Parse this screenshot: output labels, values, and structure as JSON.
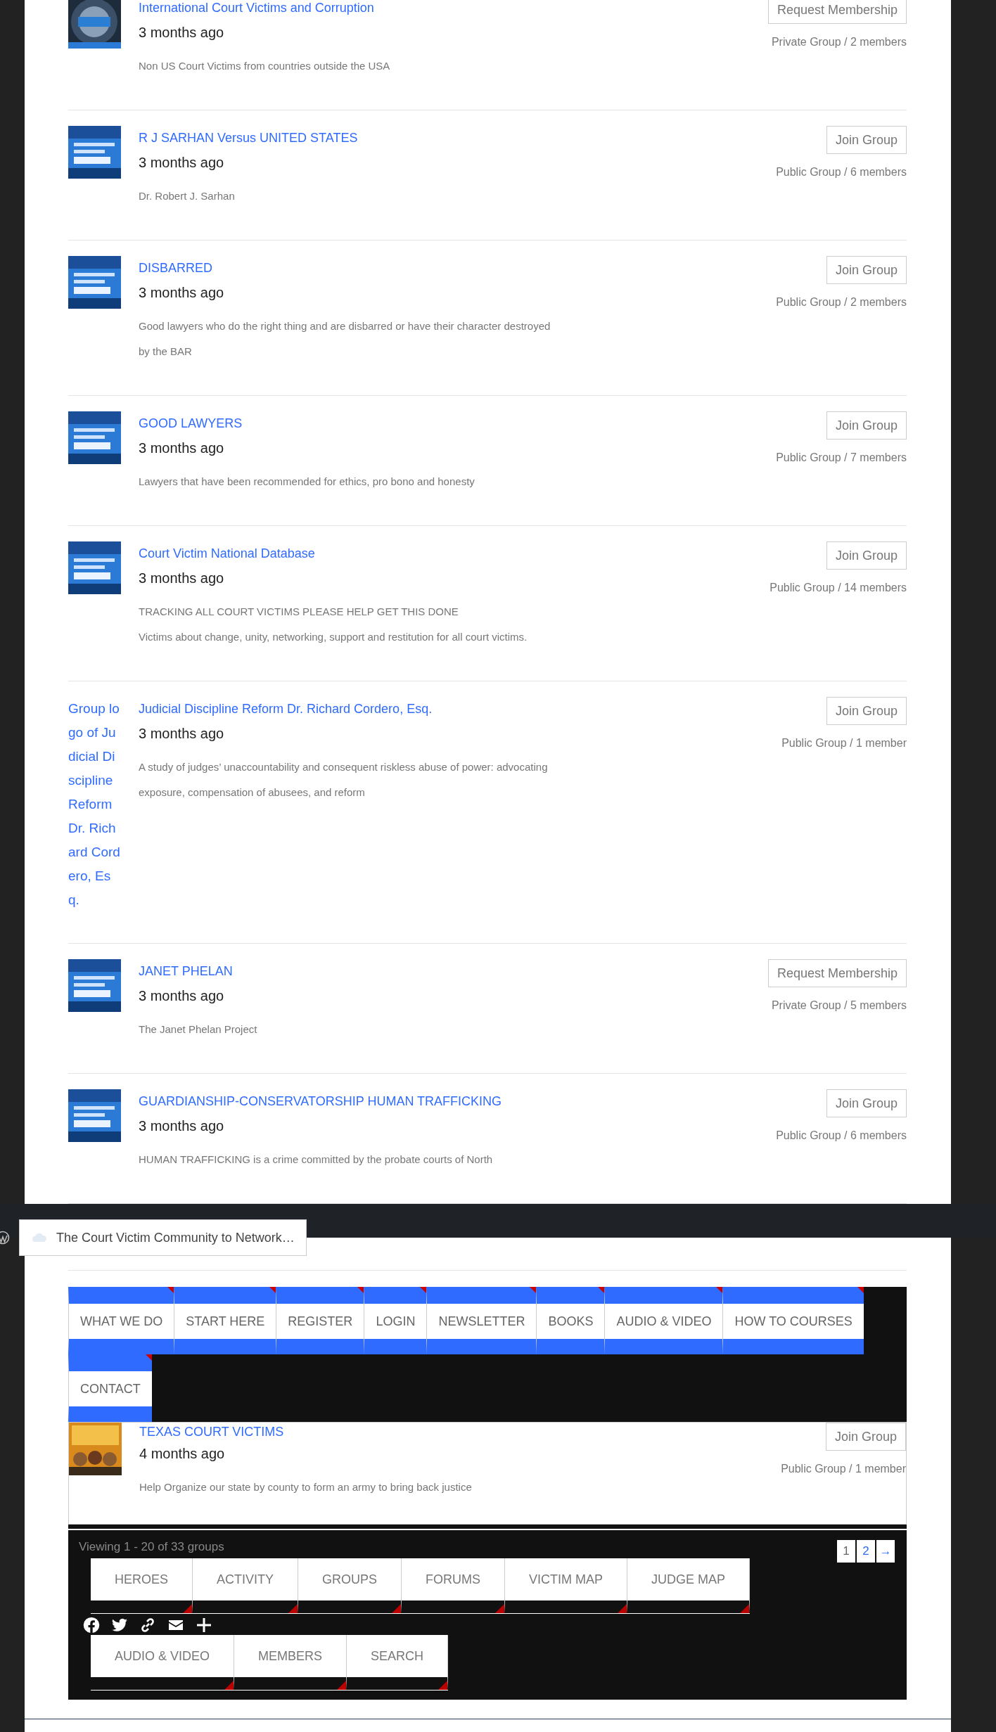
{
  "groups": [
    {
      "avatar": {
        "kind": "picture"
      },
      "title": "International Court Victims and Corruption",
      "time": "3 months ago",
      "description": [
        "Non US Court Victims from countries outside the USA"
      ],
      "action": "Request Membership",
      "meta": "Private Group / 2 members"
    },
    {
      "avatar": {
        "kind": "picture"
      },
      "title": "R J SARHAN Versus UNITED STATES",
      "time": "3 months ago",
      "description": [
        "Dr. Robert J. Sarhan"
      ],
      "action": "Join Group",
      "meta": "Public Group / 6 members"
    },
    {
      "avatar": {
        "kind": "picture"
      },
      "title": "DISBARRED",
      "time": "3 months ago",
      "description": [
        "Good lawyers who do the right thing and are disbarred or have their character destroyed by the BAR"
      ],
      "action": "Join Group",
      "meta": "Public Group / 2 members"
    },
    {
      "avatar": {
        "kind": "picture"
      },
      "title": "GOOD LAWYERS",
      "time": "3 months ago",
      "description": [
        "Lawyers that have been recommended for ethics, pro bono and honesty"
      ],
      "action": "Join Group",
      "meta": "Public Group / 7 members"
    },
    {
      "avatar": {
        "kind": "picture"
      },
      "title": "Court Victim National Database",
      "time": "3 months ago",
      "description": [
        "TRACKING ALL COURT VICTIMS PLEASE HELP GET THIS DONE",
        "Victims about change, unity, networking, support and restitution for all court victims."
      ],
      "action": "Join Group",
      "meta": "Public Group / 14 members"
    },
    {
      "avatar": {
        "kind": "alt_text",
        "text": "Group logo of Judicial Discipline Reform Dr. Richard Cordero, Esq."
      },
      "title": "Judicial Discipline Reform Dr. Richard Cordero, Esq.",
      "time": "3 months ago",
      "description": [
        "A study of judges’ unaccountability and consequent riskless abuse of power: advocating exposure, compensation of abusees, and reform"
      ],
      "action": "Join Group",
      "meta": "Public Group / 1 member"
    },
    {
      "avatar": {
        "kind": "picture"
      },
      "title": "JANET PHELAN",
      "time": "3 months ago",
      "description": [
        "The Janet Phelan Project"
      ],
      "action": "Request Membership",
      "meta": "Private Group / 5 members"
    },
    {
      "avatar": {
        "kind": "picture"
      },
      "title": "GUARDIANSHIP-CONSERVATORSHIP HUMAN TRAFFICKING",
      "time": "3 months ago",
      "description": [
        "HUMAN TRAFFICKING is a crime committed by the probate courts of North"
      ],
      "action": "Join Group",
      "meta": "Public Group / 6 members"
    }
  ],
  "tooltip": {
    "text": "The Court Victim Community to Network…"
  },
  "main_nav": [
    "WHAT WE DO",
    "START HERE",
    "REGISTER",
    "LOGIN",
    "NEWSLETTER",
    "BOOKS",
    "AUDIO & VIDEO",
    "HOW TO COURSES",
    "CONTACT"
  ],
  "featured_group": {
    "avatar": {
      "kind": "picture"
    },
    "title": "TEXAS COURT VICTIMS",
    "time": "4 months ago",
    "description": [
      "Help Organize our state by county to form an army to bring back justice"
    ],
    "action": "Join Group",
    "meta": "Public Group / 1 member"
  },
  "footer": {
    "viewing": "Viewing 1 - 20 of 33 groups",
    "pagination": [
      {
        "label": "1",
        "selected": true
      },
      {
        "label": "2",
        "selected": false
      },
      {
        "label": "→",
        "selected": false
      }
    ],
    "nav_rows": [
      [
        "HEROES",
        "ACTIVITY",
        "GROUPS",
        "FORUMS",
        "VICTIM MAP",
        "JUDGE MAP"
      ],
      [
        "AUDIO & VIDEO",
        "MEMBERS",
        "SEARCH"
      ]
    ],
    "social": [
      {
        "kind": "facebook"
      },
      {
        "kind": "bird"
      },
      {
        "kind": "link"
      },
      {
        "kind": "mail"
      },
      {
        "kind": "plus"
      }
    ]
  }
}
